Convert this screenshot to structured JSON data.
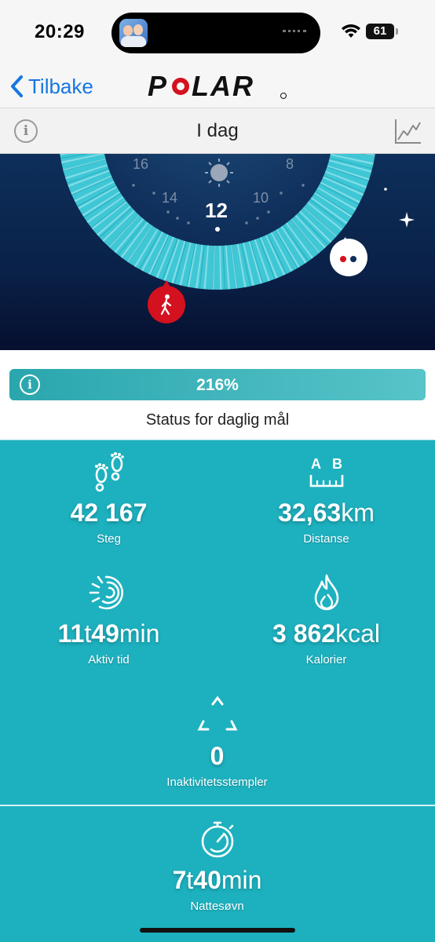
{
  "status_bar": {
    "time": "20:29",
    "battery": "61"
  },
  "nav": {
    "back_label": "Tilbake",
    "logo_text": "POLAR"
  },
  "title_bar": {
    "title": "I dag"
  },
  "dial": {
    "hour_labels": [
      "16",
      "14",
      "12",
      "10",
      "8"
    ],
    "colors": {
      "ring": "#3fc7d6",
      "background": "#0d2f5a",
      "marker": "#d4111e"
    }
  },
  "goal": {
    "percent": 216,
    "percent_label": "216%",
    "label": "Status for daglig mål"
  },
  "stats": {
    "steps": {
      "value": "42 167",
      "unit": "",
      "label": "Steg"
    },
    "distance": {
      "value": "32,63",
      "unit": "km",
      "label": "Distanse",
      "icon_labels": [
        "A",
        "B"
      ]
    },
    "active_time": {
      "value_a": "11",
      "unit_a": "t",
      "value_b": "49",
      "unit_b": "min",
      "label": "Aktiv tid"
    },
    "calories": {
      "value": "3 862",
      "unit": "kcal",
      "label": "Kalorier"
    },
    "inactivity": {
      "value": "0",
      "label": "Inaktivitetsstempler"
    },
    "sleep": {
      "value_a": "7",
      "unit_a": "t",
      "value_b": "40",
      "unit_b": "min",
      "label": "Nattesøvn"
    }
  },
  "colors": {
    "accent": "#1db1bf",
    "link": "#1677e0",
    "progress": "#2aa6ad"
  }
}
